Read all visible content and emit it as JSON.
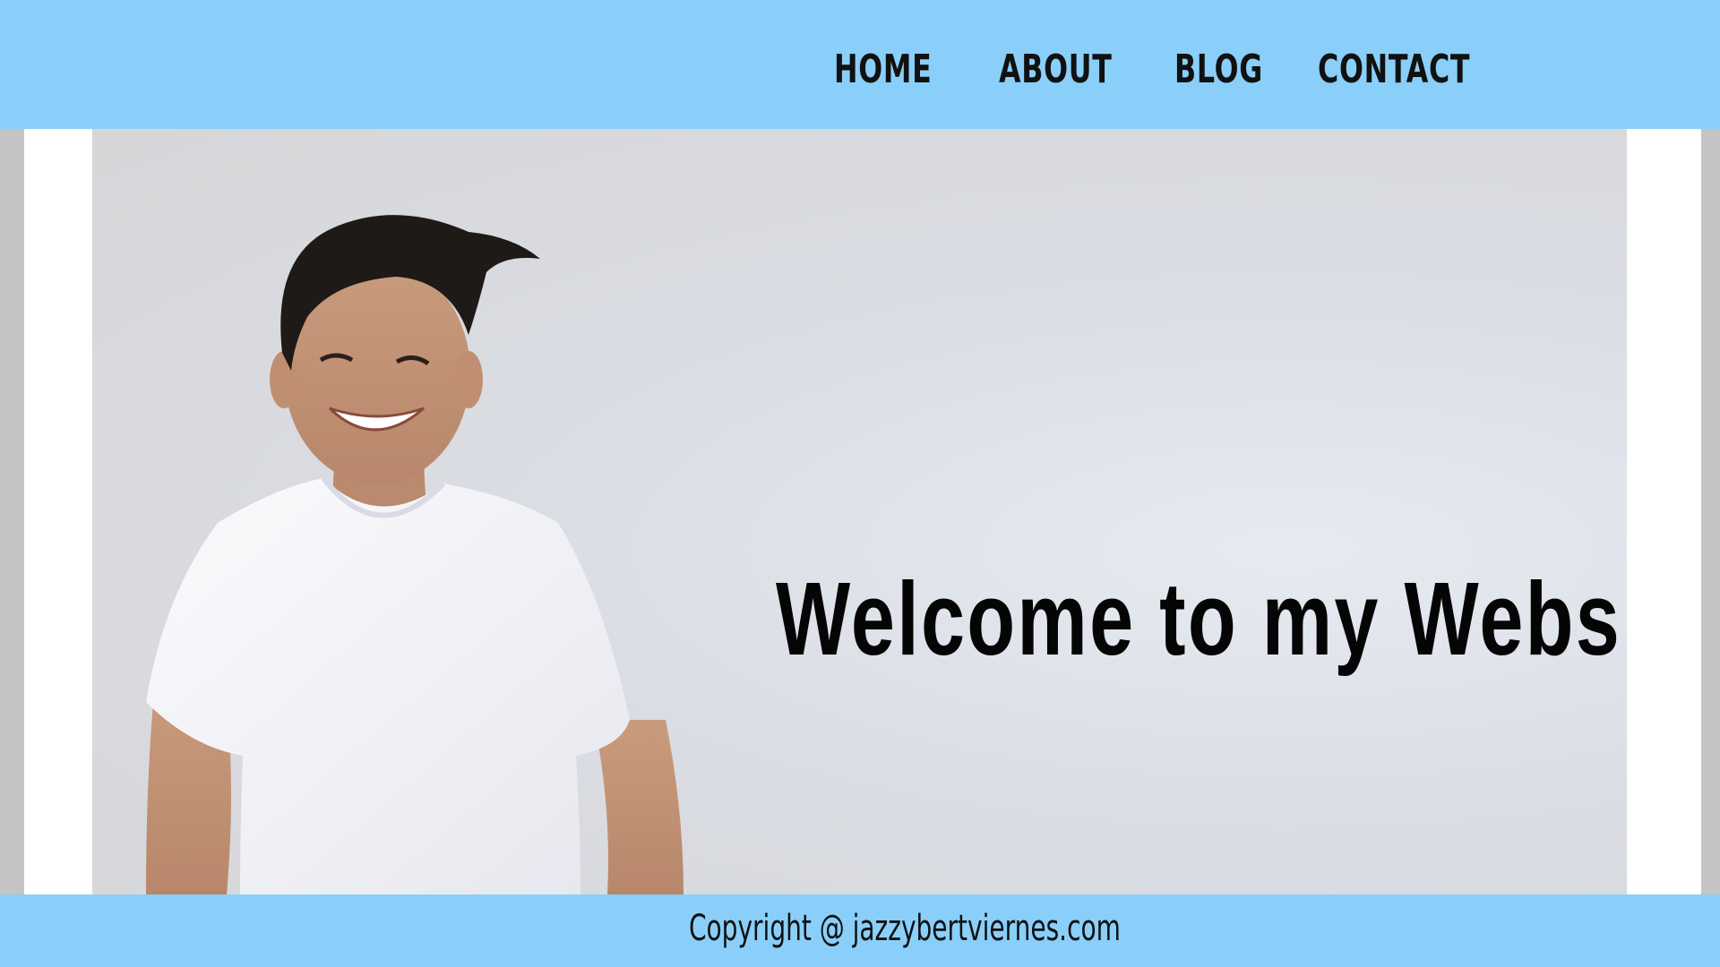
{
  "nav": {
    "items": [
      {
        "label": "HOME"
      },
      {
        "label": "ABOUT"
      },
      {
        "label": "BLOG"
      },
      {
        "label": "CONTACT"
      }
    ]
  },
  "hero": {
    "title": "Welcome to my Website",
    "image": "portrait-photo"
  },
  "footer": {
    "copyright": "Copyright @ jazzybertviernes.com"
  },
  "colors": {
    "header_bg": "#89cff9",
    "footer_bg": "#89cff9",
    "frame_bg": "#ffffff",
    "text": "#111111"
  }
}
